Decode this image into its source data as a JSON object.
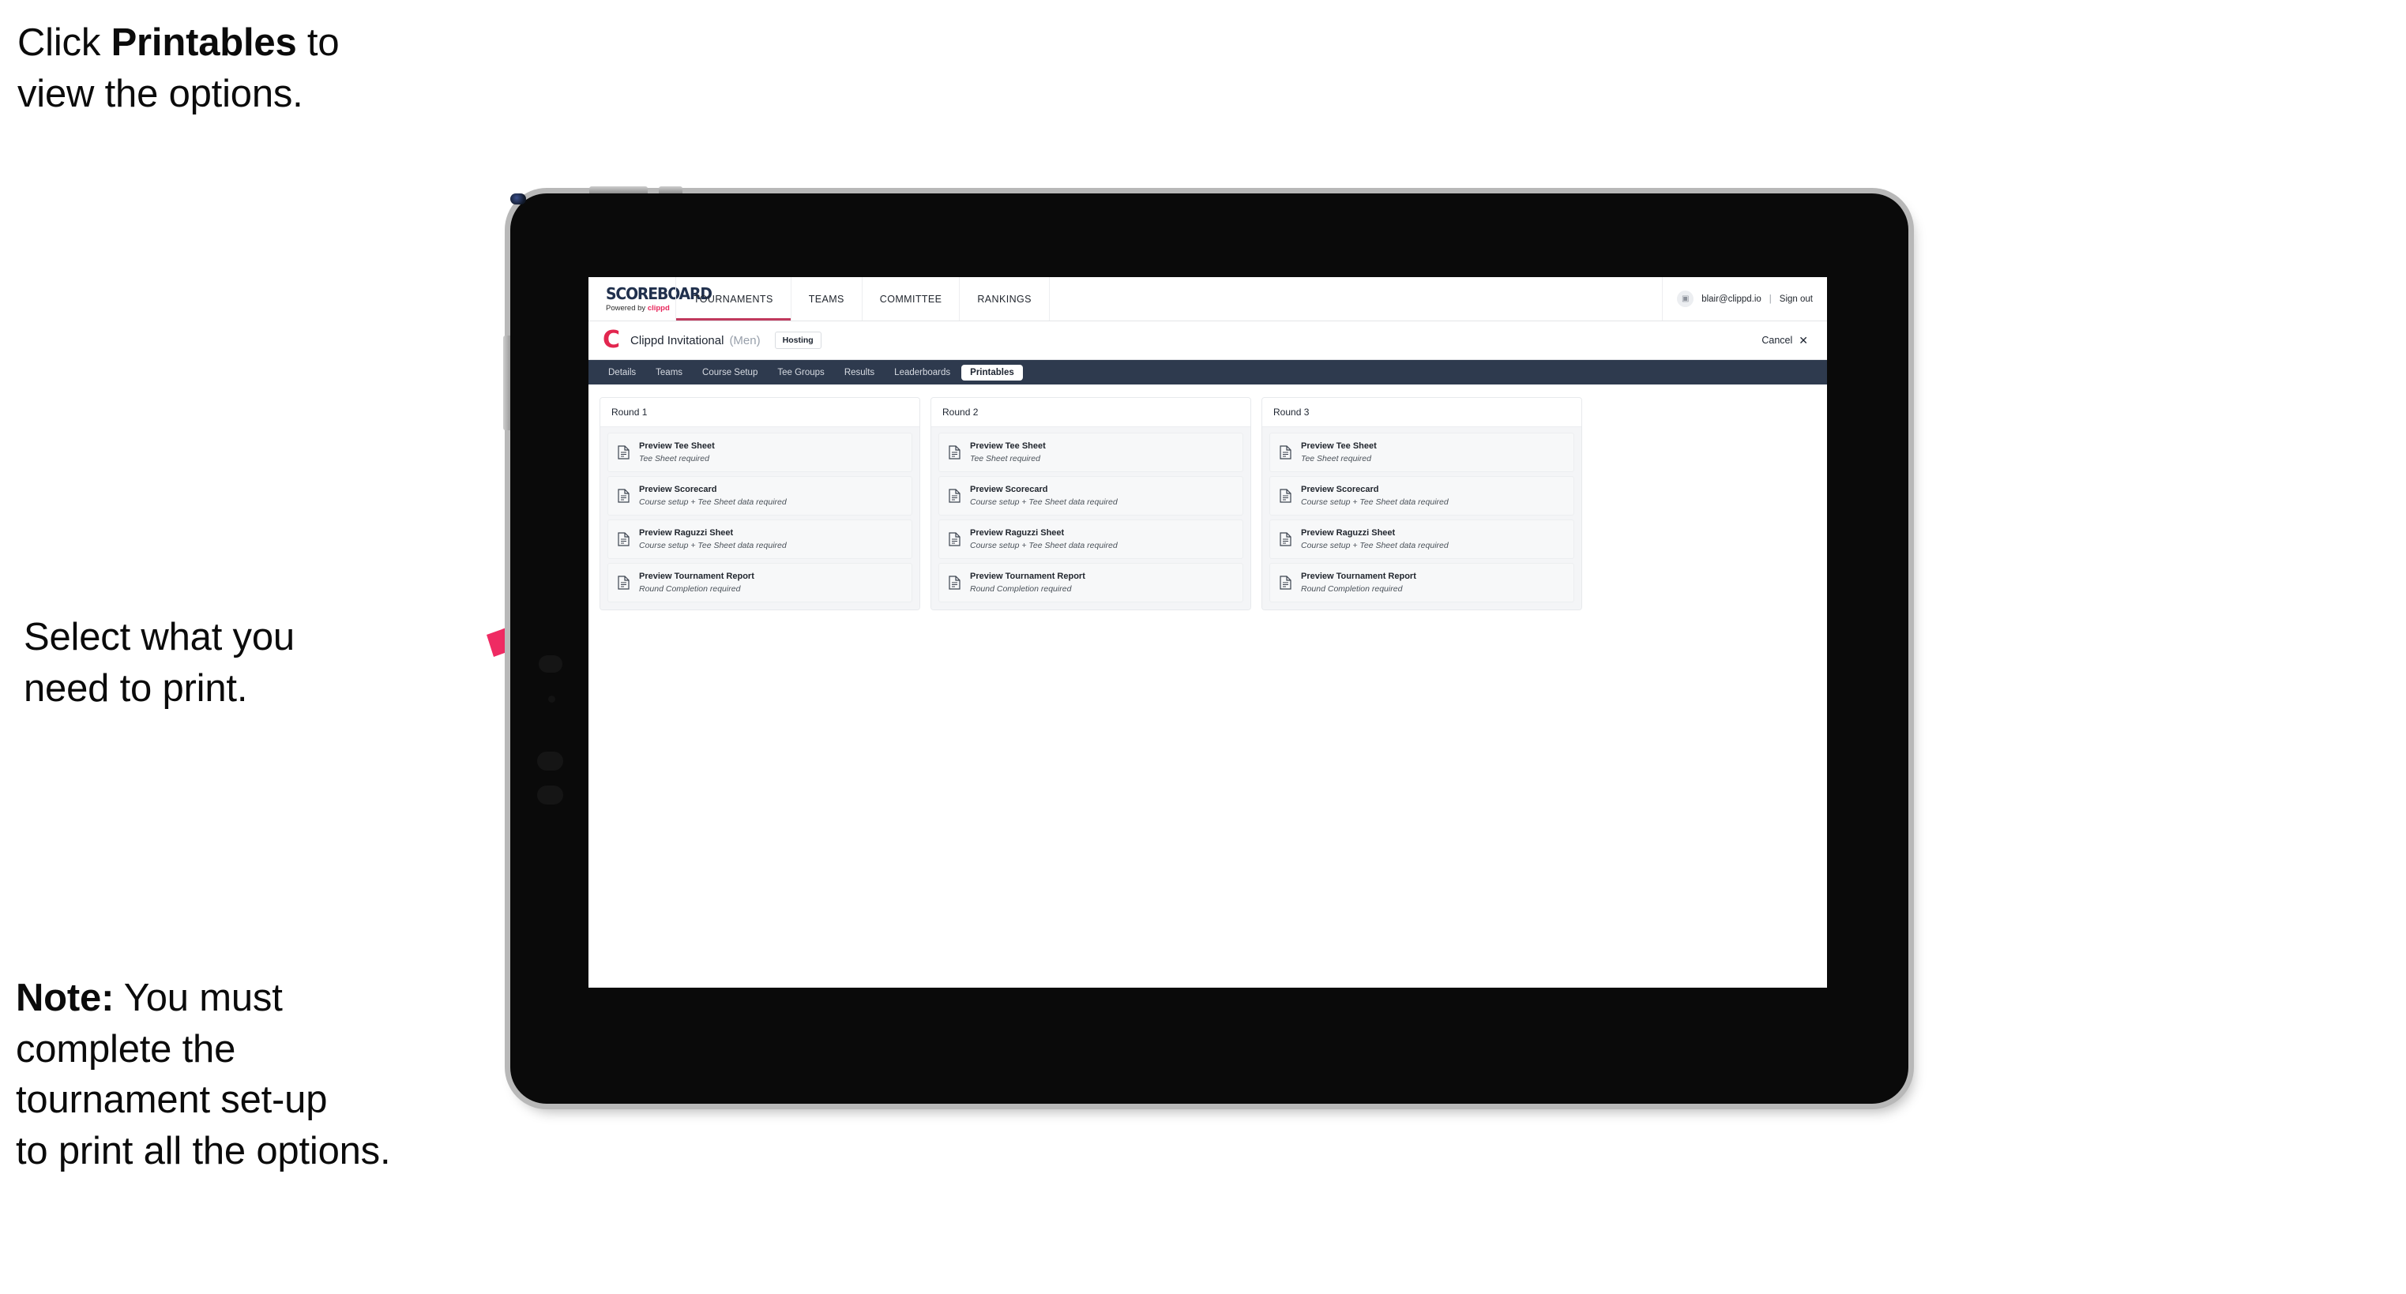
{
  "annotations": {
    "click_printables": {
      "prefix": "Click ",
      "bold": "Printables",
      "suffix": " to\nview the options."
    },
    "select_print": "Select what you\n need to print.",
    "note": {
      "bold": "Note:",
      "text": " You must\ncomplete the\ntournament set-up\nto print all the options."
    },
    "arrow_color": "#ef2b63"
  },
  "app": {
    "brand": {
      "title": "SCOREBOARD",
      "powered_prefix": "Powered by ",
      "powered_brand": "clippd"
    },
    "topnav": [
      {
        "label": "TOURNAMENTS",
        "active": true
      },
      {
        "label": "TEAMS",
        "active": false
      },
      {
        "label": "COMMITTEE",
        "active": false
      },
      {
        "label": "RANKINGS",
        "active": false
      }
    ],
    "user": {
      "avatar_glyph": "▣",
      "email": "blair@clippd.io",
      "separator": "|",
      "sign_out": "Sign out"
    },
    "tournament": {
      "logo_letter": "C",
      "name": "Clippd Invitational",
      "gender": "(Men)",
      "badge": "Hosting",
      "cancel_label": "Cancel",
      "cancel_icon": "✕"
    },
    "tabs": [
      {
        "label": "Details",
        "active": false
      },
      {
        "label": "Teams",
        "active": false
      },
      {
        "label": "Course Setup",
        "active": false
      },
      {
        "label": "Tee Groups",
        "active": false
      },
      {
        "label": "Results",
        "active": false
      },
      {
        "label": "Leaderboards",
        "active": false
      },
      {
        "label": "Printables",
        "active": true
      }
    ],
    "rounds": [
      {
        "title": "Round 1",
        "items": [
          {
            "title": "Preview Tee Sheet",
            "sub": "Tee Sheet required",
            "icon": "document-icon"
          },
          {
            "title": "Preview Scorecard",
            "sub": "Course setup + Tee Sheet data required",
            "icon": "document-icon"
          },
          {
            "title": "Preview Raguzzi Sheet",
            "sub": "Course setup + Tee Sheet data required",
            "icon": "document-icon"
          },
          {
            "title": "Preview Tournament Report",
            "sub": "Round Completion required",
            "icon": "document-icon"
          }
        ]
      },
      {
        "title": "Round 2",
        "items": [
          {
            "title": "Preview Tee Sheet",
            "sub": "Tee Sheet required",
            "icon": "document-icon"
          },
          {
            "title": "Preview Scorecard",
            "sub": "Course setup + Tee Sheet data required",
            "icon": "document-icon"
          },
          {
            "title": "Preview Raguzzi Sheet",
            "sub": "Course setup + Tee Sheet data required",
            "icon": "document-icon"
          },
          {
            "title": "Preview Tournament Report",
            "sub": "Round Completion required",
            "icon": "document-icon"
          }
        ]
      },
      {
        "title": "Round 3",
        "items": [
          {
            "title": "Preview Tee Sheet",
            "sub": "Tee Sheet required",
            "icon": "document-icon"
          },
          {
            "title": "Preview Scorecard",
            "sub": "Course setup + Tee Sheet data required",
            "icon": "document-icon"
          },
          {
            "title": "Preview Raguzzi Sheet",
            "sub": "Course setup + Tee Sheet data required",
            "icon": "document-icon"
          },
          {
            "title": "Preview Tournament Report",
            "sub": "Round Completion required",
            "icon": "document-icon"
          }
        ]
      }
    ],
    "colors": {
      "tabbar_bg": "#2e3a4e",
      "accent_pink": "#e2264f",
      "brand_navy": "#20304d",
      "active_underline": "#c0395d"
    }
  }
}
